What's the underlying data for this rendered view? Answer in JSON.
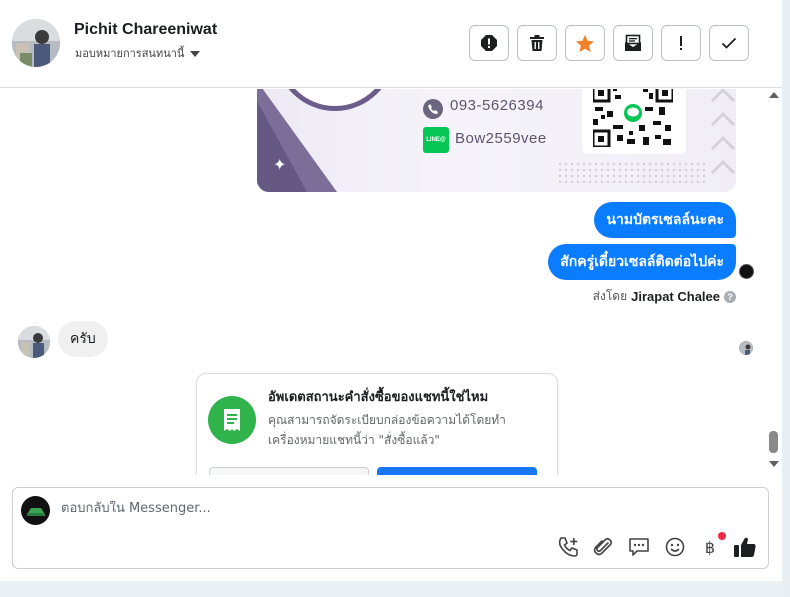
{
  "header": {
    "contact_name": "Pichit Chareeniwat",
    "assign_label": "มอบหมายการสนทนานี้",
    "toolbar": [
      {
        "name": "spam-button",
        "icon": "alert-octagon-icon"
      },
      {
        "name": "delete-button",
        "icon": "trash-icon"
      },
      {
        "name": "star-button",
        "icon": "star-icon",
        "color": "#f0812c"
      },
      {
        "name": "mark-unread-button",
        "icon": "envelope-open-icon"
      },
      {
        "name": "follow-up-button",
        "icon": "exclamation-icon"
      },
      {
        "name": "mark-done-button",
        "icon": "check-icon"
      }
    ]
  },
  "business_card": {
    "phone": "093-5626394",
    "line_badge": "LINE@",
    "line_id": "Bow2559vee"
  },
  "messages": {
    "outgoing_1": "นามบัตรเซลล์นะคะ",
    "outgoing_2": "สักครู่เดี๋ยวเซลล์ติดต่อไปค่ะ",
    "sent_by_prefix": "ส่งโดย",
    "sent_by_name": "Jirapat Chalee",
    "incoming_1": "ครับ"
  },
  "order_card": {
    "title": "อัพเดตสถานะคำสั่งซื้อของแชทนี้ใช่ไหม",
    "description": "คุณสามารถจัดระเบียบกล่องข้อความได้โดยทำเครื่องหมายแชทนี้ว่า \"สั่งซื้อแล้ว\""
  },
  "composer": {
    "placeholder": "ตอบกลับใน Messenger...",
    "icons": [
      "phone-plus-icon",
      "paperclip-icon",
      "saved-reply-icon",
      "emoji-icon",
      "baht-payment-icon",
      "thumbs-up-icon"
    ],
    "baht_symbol": "฿"
  },
  "colors": {
    "accent": "#0a7cff",
    "order_green": "#2fb34a",
    "star": "#f0812c",
    "notification": "#f02849"
  }
}
